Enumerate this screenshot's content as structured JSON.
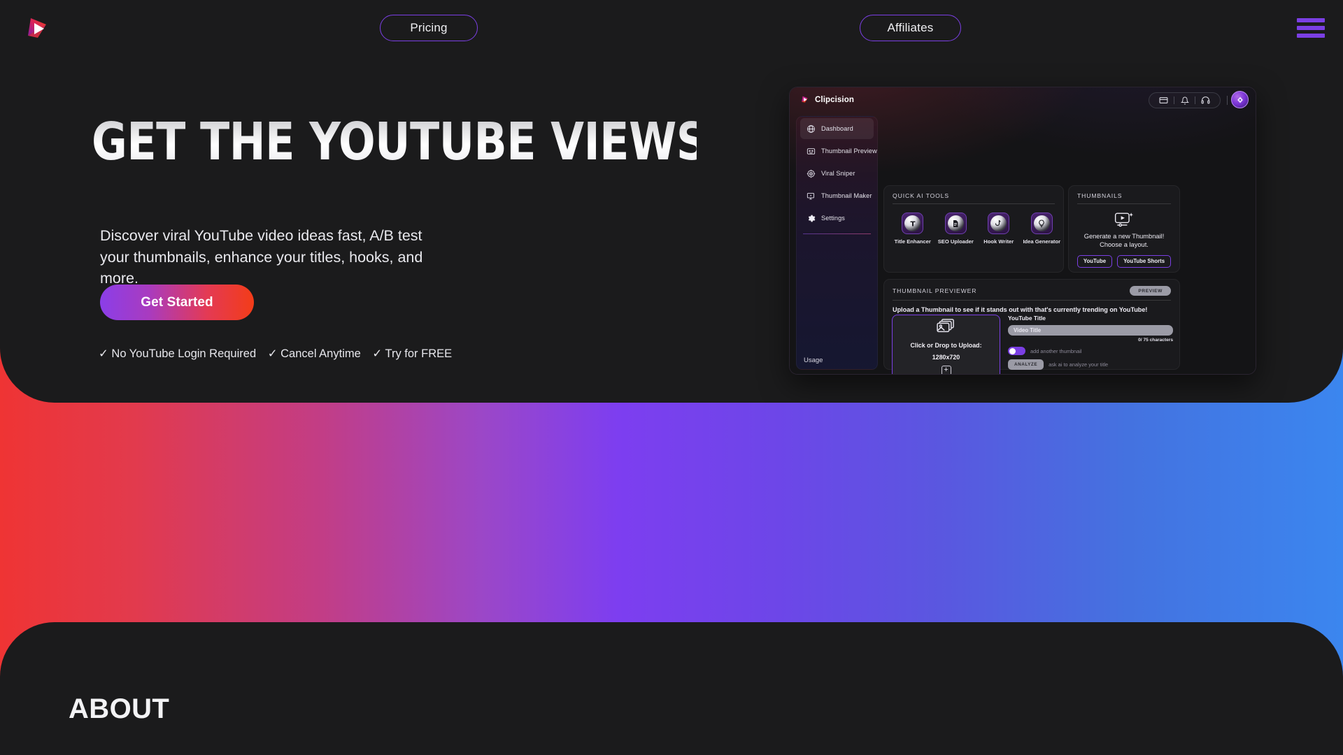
{
  "nav": {
    "logo_icon": "clipcision-play-logo",
    "pricing_label": "Pricing",
    "affiliates_label": "Affiliates",
    "menu_icon": "hamburger-menu-icon"
  },
  "hero": {
    "headline": "GET THE YOUTUBE VIEWS YOU DESERVE",
    "subcopy": "Discover viral YouTube video ideas fast, A/B test your thumbnails, enhance your titles, hooks, and more.",
    "cta_label": "Get Started",
    "badges": [
      "✓ No YouTube Login Required",
      "✓ Cancel Anytime",
      "✓ Try for FREE"
    ]
  },
  "app": {
    "brand": "Clipcision",
    "top_icons": [
      "card-icon",
      "bell-icon",
      "headset-icon"
    ],
    "avatar_icon": "user-avatar-icon",
    "sidebar": {
      "items": [
        {
          "label": "Dashboard",
          "icon": "globe-icon",
          "active": true
        },
        {
          "label": "Thumbnail Previewer",
          "icon": "image-preview-icon",
          "active": false
        },
        {
          "label": "Viral Sniper",
          "icon": "target-icon",
          "active": false
        },
        {
          "label": "Thumbnail Maker",
          "icon": "monitor-play-icon",
          "active": false
        },
        {
          "label": "Settings",
          "icon": "gear-icon",
          "active": false
        }
      ],
      "usage_label": "Usage"
    },
    "quick_tools": {
      "title": "QUICK AI TOOLS",
      "tools": [
        {
          "label": "Title Enhancer",
          "icon": "title-enhancer-icon"
        },
        {
          "label": "SEO Uploader",
          "icon": "document-upload-icon"
        },
        {
          "label": "Hook Writer",
          "icon": "hook-icon"
        },
        {
          "label": "Idea Generator",
          "icon": "lightbulb-icon"
        }
      ]
    },
    "thumbnails": {
      "title": "THUMBNAILS",
      "icon": "video-sparkle-icon",
      "line1": "Generate a new Thumbnail!",
      "line2": "Choose a layout.",
      "buttons": [
        "YouTube",
        "YouTube Shorts"
      ]
    },
    "previewer": {
      "title": "THUMBNAIL PREVIEWER",
      "preview_button": "PREVIEW",
      "subtitle": "Upload a Thumbnail to see if it stands out with that's currently trending on YouTube!",
      "upload": {
        "icon": "images-stack-icon",
        "line1": "Click or Drop to Upload:",
        "line2": "1280x720",
        "add_icon": "plus-icon"
      },
      "title_field": {
        "label": "YouTube Title",
        "value": "Video Title",
        "placeholder": "Video Title",
        "counter": "0/ 75 characters"
      },
      "toggle_label": "add another thumbnail",
      "analyze_button": "ANALYZE",
      "analyze_hint": "ask ai to analyze your title"
    }
  },
  "about": {
    "title": "ABOUT"
  },
  "colors": {
    "accent_purple": "#7b3fe4",
    "dark_panel": "#1b1b1c",
    "gradient_start": "#ef3434",
    "gradient_mid": "#7d3ef0",
    "gradient_end": "#3b86ef"
  }
}
